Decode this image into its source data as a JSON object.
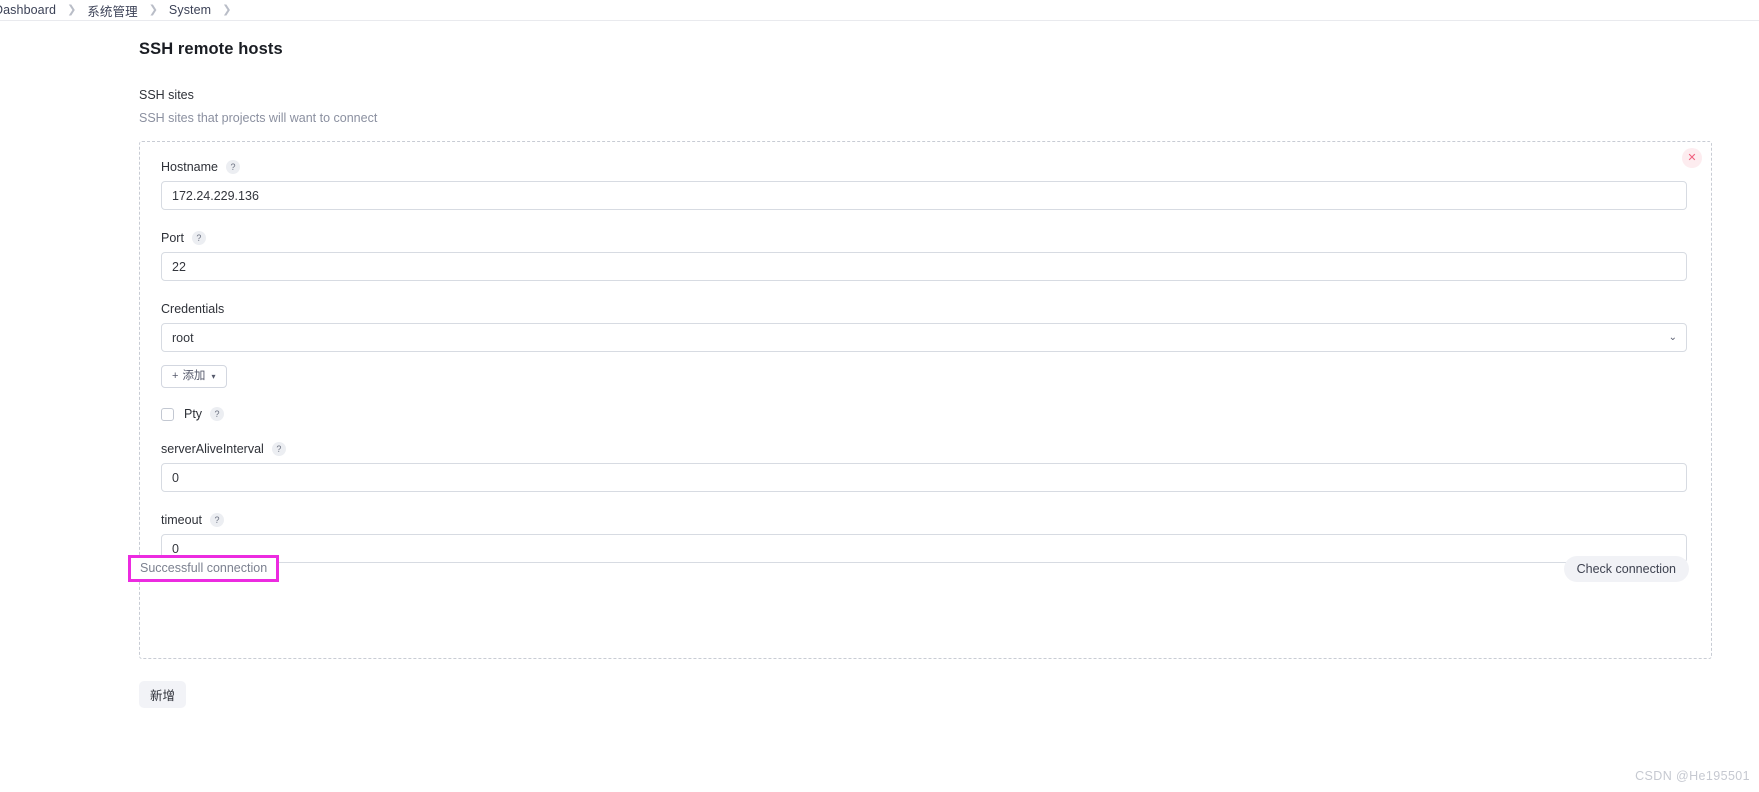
{
  "breadcrumb": {
    "items": [
      {
        "label": "Dashboard"
      },
      {
        "label": "系统管理"
      },
      {
        "label": "System"
      }
    ],
    "separator": "❯"
  },
  "page": {
    "title": "SSH remote hosts",
    "section_label": "SSH sites",
    "section_sub": "SSH sites that projects will want to connect"
  },
  "card": {
    "close_icon": "✕",
    "fields": {
      "hostname": {
        "label": "Hostname",
        "help": "?",
        "value": "172.24.229.136"
      },
      "port": {
        "label": "Port",
        "help": "?",
        "value": "22"
      },
      "credentials": {
        "label": "Credentials",
        "value": "root",
        "chevron": "⌄",
        "add_button": {
          "plus": "+",
          "label": "添加",
          "caret": "▾"
        }
      },
      "pty": {
        "label": "Pty",
        "help": "?",
        "checked": false
      },
      "server_alive_interval": {
        "label": "serverAliveInterval",
        "help": "?",
        "value": "0"
      },
      "timeout": {
        "label": "timeout",
        "help": "?",
        "value": "0"
      }
    },
    "result_message": "Successfull connection",
    "check_button": "Check connection",
    "highlight_color": "#ec2be0"
  },
  "footer": {
    "new_button": "新增",
    "watermark": "CSDN @He195501"
  }
}
